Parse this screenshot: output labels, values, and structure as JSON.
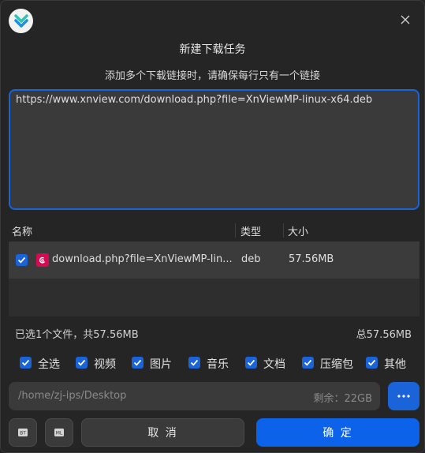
{
  "dialog": {
    "title": "新建下载任务",
    "subtitle": "添加多个下载链接时，请确保每行只有一个链接",
    "url_input_value": "https://www.xnview.com/download.php?file=XnViewMP-linux-x64.deb"
  },
  "table": {
    "columns": [
      "名称",
      "类型",
      "大小"
    ],
    "rows": [
      {
        "checked": true,
        "icon": "debian-package-icon",
        "name": "download.php?file=XnViewMP-lin...",
        "type": "deb",
        "size": "57.56MB"
      }
    ]
  },
  "summary": {
    "selected_text": "已选1个文件，共57.56MB",
    "total_text": "总57.56MB"
  },
  "filters": [
    {
      "label": "全选",
      "checked": true
    },
    {
      "label": "视频",
      "checked": true
    },
    {
      "label": "图片",
      "checked": true
    },
    {
      "label": "音乐",
      "checked": true
    },
    {
      "label": "文档",
      "checked": true
    },
    {
      "label": "压缩包",
      "checked": true
    },
    {
      "label": "其他",
      "checked": true
    }
  ],
  "save_path": {
    "path": "/home/zj-ips/Desktop",
    "free_space": "剩余：22GB"
  },
  "buttons": {
    "cancel": "取 消",
    "confirm": "确 定",
    "more": "..."
  },
  "colors": {
    "accent": "#0c62e8",
    "background": "#252525"
  }
}
